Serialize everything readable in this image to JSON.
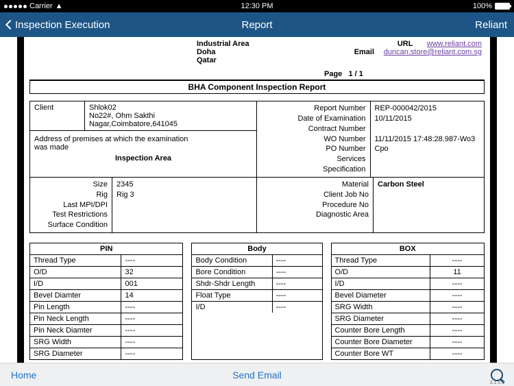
{
  "status": {
    "carrier": "Carrier",
    "time": "12:30 PM",
    "battery": "100%"
  },
  "nav": {
    "back": "Inspection Execution",
    "title": "Report",
    "right": "Reliant"
  },
  "header": {
    "address1": "Industrial Area",
    "address2": "Doha",
    "address3": "Qatar",
    "url_label": "URL",
    "url": "www.reliant.com",
    "email_label": "Email",
    "email": "duncan.store@reliant.com.sg",
    "page_label": "Page",
    "page_value": "1 / 1"
  },
  "section_title": "BHA Component Inspection Report",
  "info": {
    "client_label": "Client",
    "client_name": "Shlok02",
    "client_addr1": "No22#, Ohm Sakthi",
    "client_addr2": "Nagar,Coimbatore,641045",
    "address_note1": "Address of premises at which the examination",
    "address_note2": "was made",
    "inspection_area": "Inspection Area",
    "right_labels": {
      "report_no": "Report  Number",
      "date_exam": "Date of Examination",
      "contract_no": "Contract Number",
      "wo_no": "WO Number",
      "po_no": "PO Number",
      "services": "Services",
      "spec": "Specification"
    },
    "right_values": {
      "report_no": "REP-000042/2015",
      "date_exam": "10/11/2015",
      "contract_no": "",
      "wo_no": "11/11/2015 17:48:28.987-Wo3",
      "po_no": "Cpo",
      "services": "",
      "spec": ""
    }
  },
  "area": {
    "left_labels": {
      "size": "Size",
      "rig": "Rig",
      "mpi": "Last MPI/DPI",
      "restrict": "Test Restrictions",
      "surface": "Surface Condition"
    },
    "left_values": {
      "size": "2345",
      "rig": "Rig 3",
      "mpi": "",
      "restrict": "",
      "surface": ""
    },
    "right_labels": {
      "material": "Material",
      "cjob": "Client Job No",
      "proc": "Procedure No",
      "diag": "Diagnostic Area"
    },
    "right_values": {
      "material": "Carbon Steel",
      "cjob": "",
      "proc": "",
      "diag": ""
    }
  },
  "pin": {
    "title": "PIN",
    "rows": [
      {
        "l": "Thread Type",
        "v": "----"
      },
      {
        "l": "O/D",
        "v": "32"
      },
      {
        "l": "I/D",
        "v": "001"
      },
      {
        "l": "Bevel Diamter",
        "v": "14"
      },
      {
        "l": "Pin Length",
        "v": "----"
      },
      {
        "l": "Pin Neck Length",
        "v": "----"
      },
      {
        "l": "Pin Neck Diamter",
        "v": "----"
      },
      {
        "l": "SRG Width",
        "v": "----"
      },
      {
        "l": "SRG Diameter",
        "v": "----"
      }
    ]
  },
  "bodytbl": {
    "title": "Body",
    "rows": [
      {
        "l": "Body Condition",
        "v": "----"
      },
      {
        "l": "Bore Condition",
        "v": "----"
      },
      {
        "l": "Shdr-Shdr Length",
        "v": "----"
      },
      {
        "l": "Float Type",
        "v": "----"
      },
      {
        "l": "I/D",
        "v": "----"
      }
    ]
  },
  "box": {
    "title": "BOX",
    "rows": [
      {
        "l": "Thread Type",
        "v": "----"
      },
      {
        "l": "O/D",
        "v": "11"
      },
      {
        "l": "I/D",
        "v": "----"
      },
      {
        "l": "Bevel Diameter",
        "v": "----"
      },
      {
        "l": "SRG Width",
        "v": "----"
      },
      {
        "l": "SRG Diameter",
        "v": "----"
      },
      {
        "l": "Counter Bore Length",
        "v": "----"
      },
      {
        "l": "Counter Bore Diameter",
        "v": "----"
      },
      {
        "l": "Counter Bore WT",
        "v": "----"
      }
    ]
  },
  "bottom": {
    "home": "Home",
    "send": "Send Email",
    "version": "3.1.5.3"
  }
}
